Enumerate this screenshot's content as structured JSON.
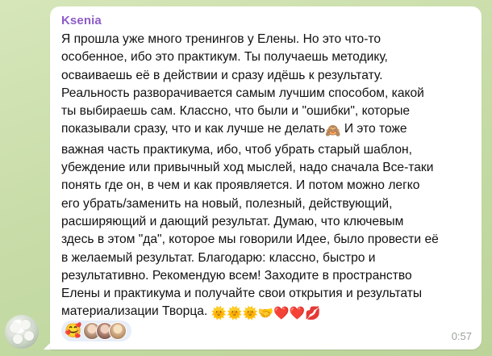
{
  "message": {
    "sender": "Ksenia",
    "lines": [
      "Я прошла уже много тренингов у Елены. Но это что-то",
      "особенное, ибо это практикум. Ты получаешь методику,",
      "осваиваешь её в действии и сразу идёшь к результату.",
      "Реальность разворачивается самым лучшим способом, какой",
      "ты выбираешь сам. Классно, что были и \"ошибки\", которые",
      "показывали сразу, что и как лучше не делать",
      " И это тоже",
      "важная  часть практикума, ибо, чтоб убрать старый шаблон,",
      "убеждение или привычный ход мыслей, надо сначала Все-таки",
      "понять где он, в чем и как проявляется. И потом можно легко",
      "его убрать/заменить на новый, полезный, действующий,",
      "расширяющий и дающий результат. Думаю, что ключевым",
      "здесь в этом \"да\", которое мы говорили Идее, было провести её",
      "в желаемый результат. Благодарю: классно, быстро и",
      "результативно. Рекомендую всем! Заходите в пространство",
      "Елены и практикума и получайте свои открытия и результаты",
      "материализации Творца."
    ],
    "inline_emoji_line6": "🙈",
    "trailing_emojis": "🌞🌞🌞🤝❤️❤️💋",
    "time": "0:57"
  },
  "reactions": {
    "emoji": "🥰",
    "avatar_icons": [
      "user-avatar-1",
      "user-avatar-2",
      "user-avatar-3"
    ],
    "avatar_colors": [
      "#c9a48a",
      "#b98a7a",
      "#d8b28c"
    ]
  },
  "colors": {
    "sender_name": "#8e5cc9",
    "bubble": "#ffffff",
    "background": "#cfe0b4",
    "time": "#9aa39a"
  }
}
